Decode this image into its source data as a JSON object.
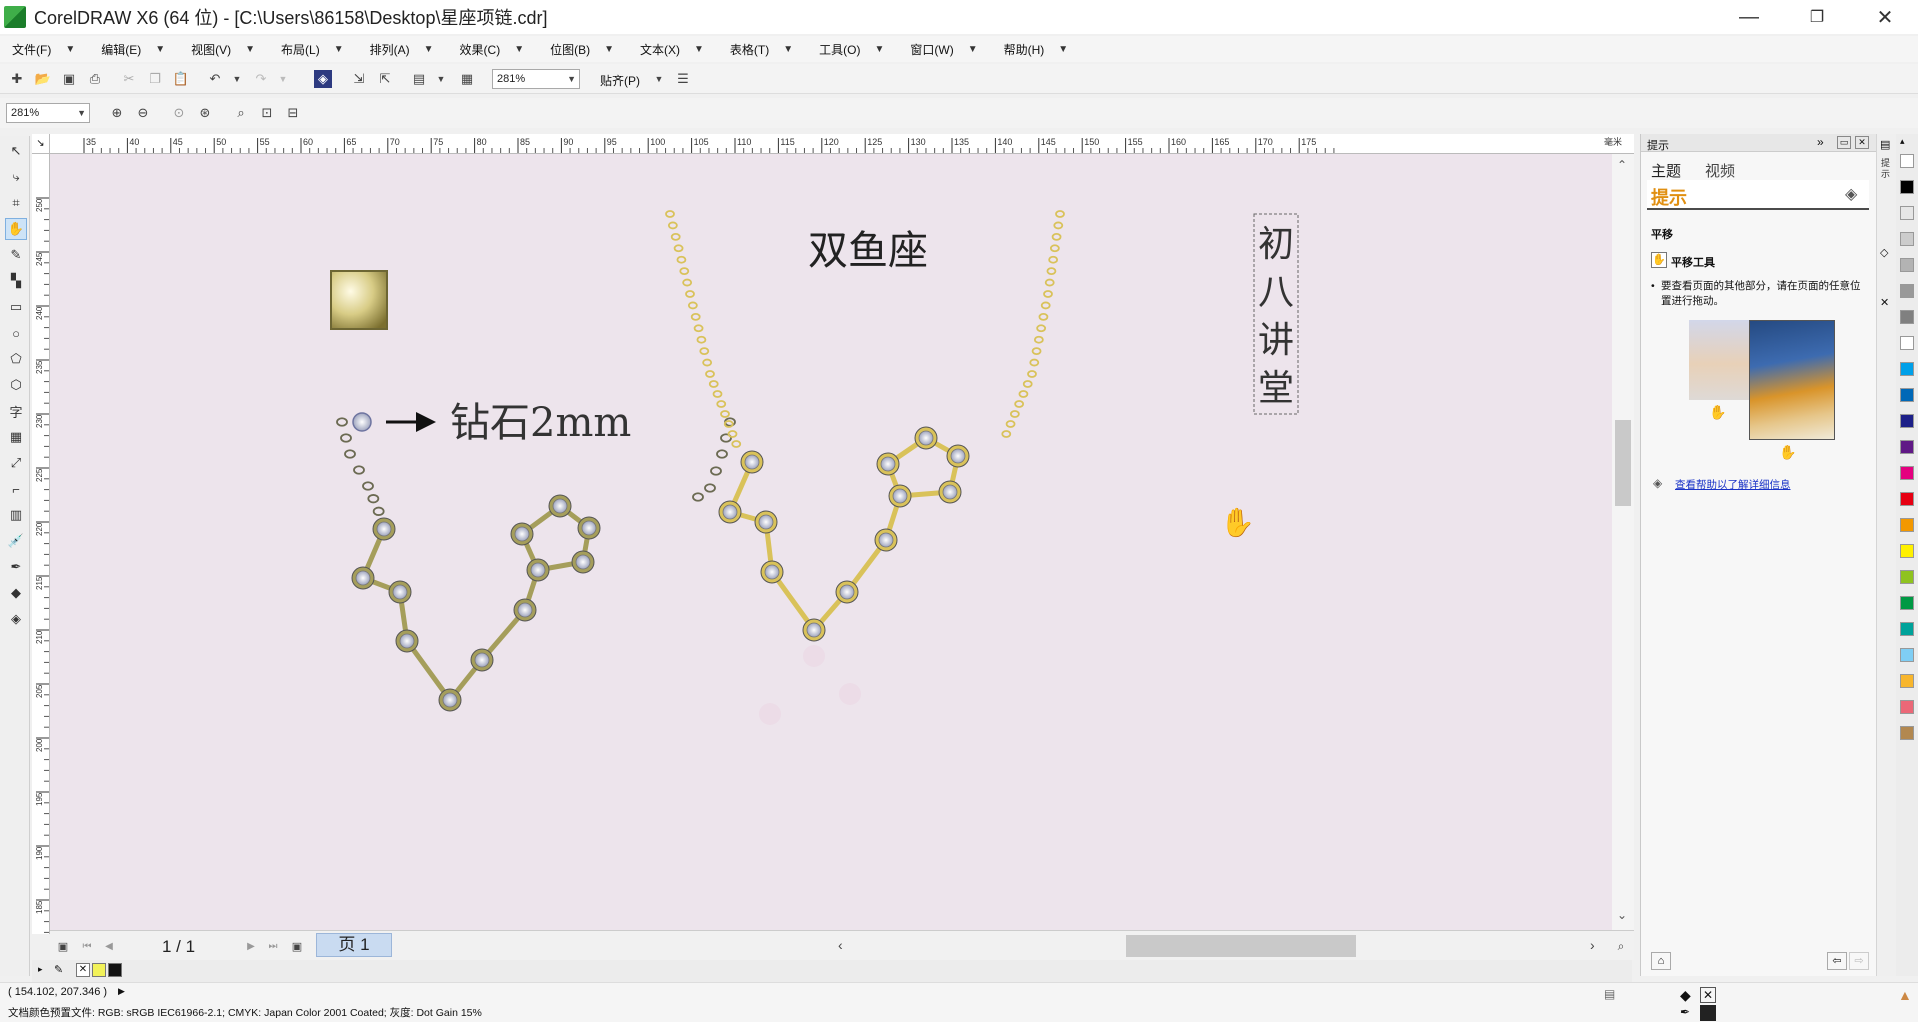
{
  "window": {
    "title": "CorelDRAW X6 (64 位) - [C:\\Users\\86158\\Desktop\\星座项链.cdr]",
    "minimize": "—",
    "restore": "❐",
    "close": "✕"
  },
  "menu": [
    {
      "label": "文件(F)"
    },
    {
      "label": "编辑(E)"
    },
    {
      "label": "视图(V)"
    },
    {
      "label": "布局(L)"
    },
    {
      "label": "排列(A)"
    },
    {
      "label": "效果(C)"
    },
    {
      "label": "位图(B)"
    },
    {
      "label": "文本(X)"
    },
    {
      "label": "表格(T)"
    },
    {
      "label": "工具(O)"
    },
    {
      "label": "窗口(W)"
    },
    {
      "label": "帮助(H)"
    }
  ],
  "toolbar": {
    "zoom_value": "281%",
    "snap_label": "贴齐(P)",
    "zoom_levels_value": "281%"
  },
  "ruler": {
    "h_ticks": [
      "35",
      "40",
      "45",
      "50",
      "55",
      "60",
      "65",
      "70",
      "75",
      "80",
      "85",
      "90",
      "95",
      "100",
      "105",
      "110",
      "115",
      "120",
      "125",
      "130",
      "135",
      "140",
      "145",
      "150",
      "155",
      "160",
      "165",
      "170",
      "175"
    ],
    "unit": "毫米",
    "v_ticks": [
      "250",
      "245",
      "240",
      "235",
      "230",
      "225",
      "220",
      "215",
      "210",
      "205",
      "200",
      "195",
      "190",
      "185"
    ]
  },
  "canvas": {
    "title_text": "双鱼座",
    "diamond_label": "钻石2mm",
    "vertical_text": [
      "初",
      "八",
      "讲",
      "堂"
    ],
    "colors": {
      "page_bg": "#ede4ec",
      "gold": "#d9c25a",
      "metal": "#a59e5b",
      "diamond": "#8f96b4"
    }
  },
  "page_nav": {
    "counter": "1 / 1",
    "page_tab": "页 1"
  },
  "status": {
    "coords": "( 154.102, 207.346 )",
    "color_profile": "文档颜色预置文件: RGB: sRGB IEC61966-2.1; CMYK: Japan Color 2001 Coated; 灰度: Dot Gain 15%"
  },
  "docker": {
    "header": "提示",
    "tabs": [
      "主题",
      "视频"
    ],
    "section_title": "提示",
    "subheading": "平移",
    "tool_name": "平移工具",
    "description": "要查看页面的其他部分，请在页面的任意位置进行拖动。",
    "help_link": "查看帮助以了解详细信息"
  },
  "icons": {
    "hand": "hand-icon",
    "app": "coreldraw-icon"
  }
}
